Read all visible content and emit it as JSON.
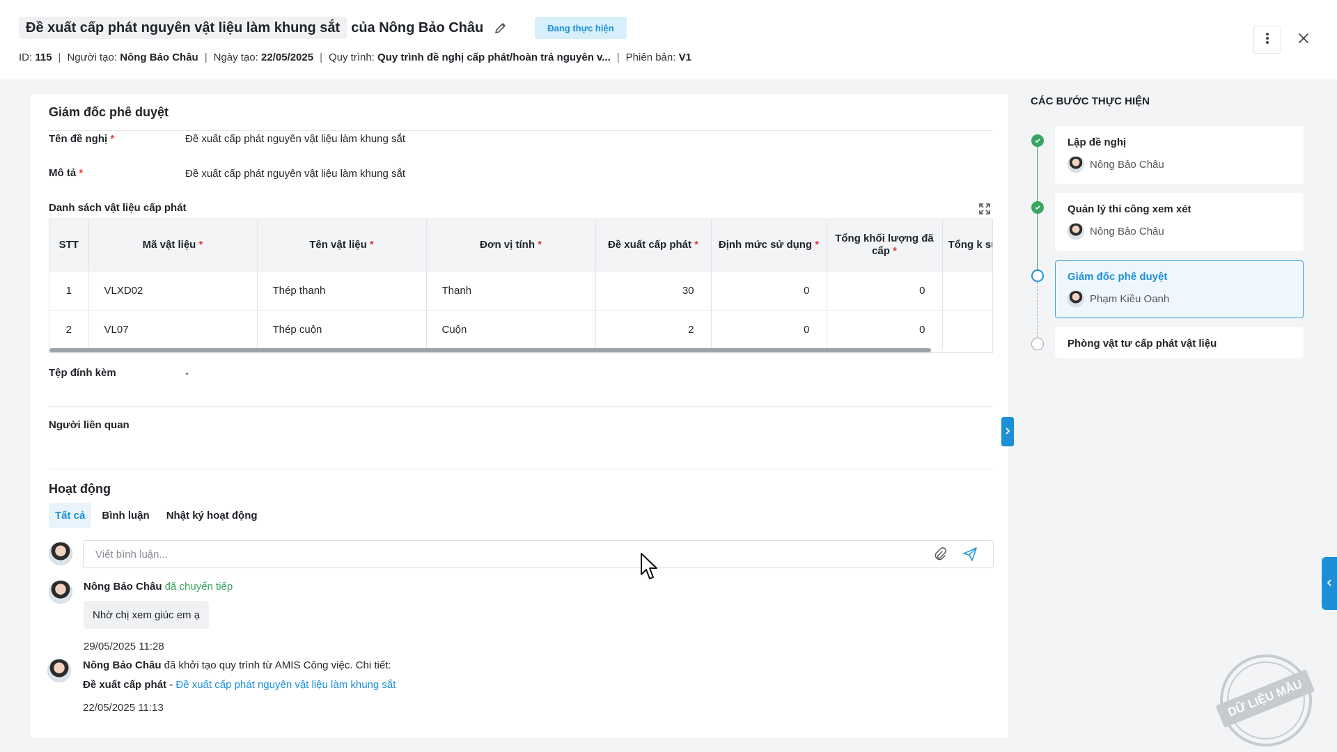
{
  "header": {
    "title": "Đề xuất cấp phát nguyên vật liệu làm khung sắt",
    "owner": "của Nông Bảo Châu",
    "status": "Đang thực hiện",
    "meta": {
      "id_label": "ID:",
      "id_value": "115",
      "creator_label": "Người tạo:",
      "creator_value": "Nông Bảo Châu",
      "date_label": "Ngày tạo:",
      "date_value": "22/05/2025",
      "process_label": "Quy trình:",
      "process_value": "Quy trình đề nghị cấp phát/hoàn trả nguyên v...",
      "version_label": "Phiên bản:",
      "version_value": "V1",
      "separator": "|"
    }
  },
  "section": {
    "title": "Giám đốc phê duyệt",
    "fields": {
      "name_label": "Tên đề nghị",
      "name_value": "Đề xuất cấp phát nguyên vật liệu làm khung sắt",
      "desc_label": "Mô tả",
      "desc_value": "Đề xuất cấp phát nguyên vật liệu làm khung sắt",
      "required_mark": "*"
    },
    "table_title": "Danh sách vật liệu cấp phát",
    "table": {
      "headers": [
        "STT",
        "Mã vật liệu",
        "Tên vật liệu",
        "Đơn vị tính",
        "Đề xuất cấp phát",
        "Định mức sử dụng",
        "Tổng khối lượng đã cấp",
        "Tổng k sử"
      ],
      "rows": [
        {
          "stt": "1",
          "code": "VLXD02",
          "name": "Thép thanh",
          "unit": "Thanh",
          "proposed": "30",
          "norm": "0",
          "issued": "0"
        },
        {
          "stt": "2",
          "code": "VL07",
          "name": "Thép cuộn",
          "unit": "Cuộn",
          "proposed": "2",
          "norm": "0",
          "issued": "0"
        }
      ]
    },
    "attachments_label": "Tệp đính kèm",
    "attachments_value": "-",
    "related_label": "Người liên quan"
  },
  "activity": {
    "title": "Hoạt động",
    "tabs": [
      "Tất cả",
      "Bình luận",
      "Nhật ký hoạt động"
    ],
    "comment_placeholder": "Viết bình luận...",
    "items": [
      {
        "name": "Nông Bảo Châu",
        "verb": "đã chuyển tiếp",
        "message": "Nhờ chị xem giúc em ạ",
        "time": "29/05/2025 11:28"
      },
      {
        "name": "Nông Bảo Châu",
        "verb": "đã khởi tạo quy trình từ AMIS Công việc. Chi tiết:",
        "detail_label": "Đề xuất cấp phát",
        "detail_sep": "-",
        "detail_link": "Đề xuất cấp phát nguyên vật liệu làm khung sắt",
        "time": "22/05/2025 11:13"
      }
    ]
  },
  "steps": {
    "title": "CÁC BƯỚC THỰC HIỆN",
    "items": [
      {
        "name": "Lập đề nghị",
        "person": "Nông Bảo Châu",
        "state": "done"
      },
      {
        "name": "Quản lý thi công xem xét",
        "person": "Nông Bảo Châu",
        "state": "done"
      },
      {
        "name": "Giám đốc phê duyệt",
        "person": "Phạm Kiều Oanh",
        "state": "current"
      },
      {
        "name": "Phòng vật tư cấp phát vật liệu",
        "person": "",
        "state": "pending"
      }
    ]
  },
  "watermark": "DỮ LIỆU MẪU",
  "colors": {
    "accent": "#1d8fd8",
    "success": "#3aa55e",
    "required": "#e53935",
    "badge_bg": "#d6effb"
  }
}
